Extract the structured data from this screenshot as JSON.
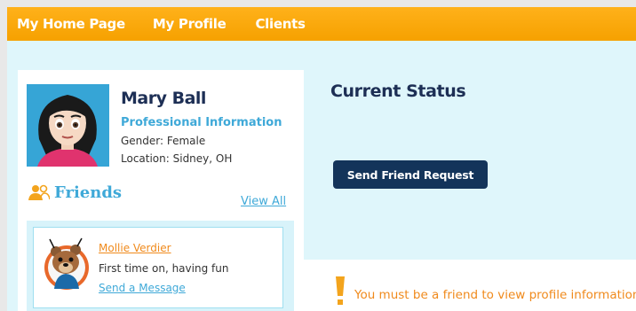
{
  "nav": {
    "items": [
      {
        "label": "My Home Page"
      },
      {
        "label": "My Profile"
      },
      {
        "label": "Clients"
      }
    ]
  },
  "profile": {
    "name": "Mary Ball",
    "section_title": "Professional Information",
    "gender": "Gender: Female",
    "location": "Location: Sidney, OH"
  },
  "friends": {
    "title": "Friends",
    "view_all": "View All",
    "items": [
      {
        "name": "Mollie Verdier",
        "status": "First time on, having fun",
        "action": "Send a Message"
      }
    ]
  },
  "status": {
    "title": "Current Status",
    "button_label": "Send Friend Request",
    "warning": "You must be a friend to view profile information"
  },
  "colors": {
    "nav_orange": "#f6a100",
    "bg_light_blue": "#dff6fb",
    "navy": "#1d2f55",
    "accent_blue": "#3fa9d8",
    "warning_orange": "#f08a1c",
    "button_navy": "#13345a"
  }
}
